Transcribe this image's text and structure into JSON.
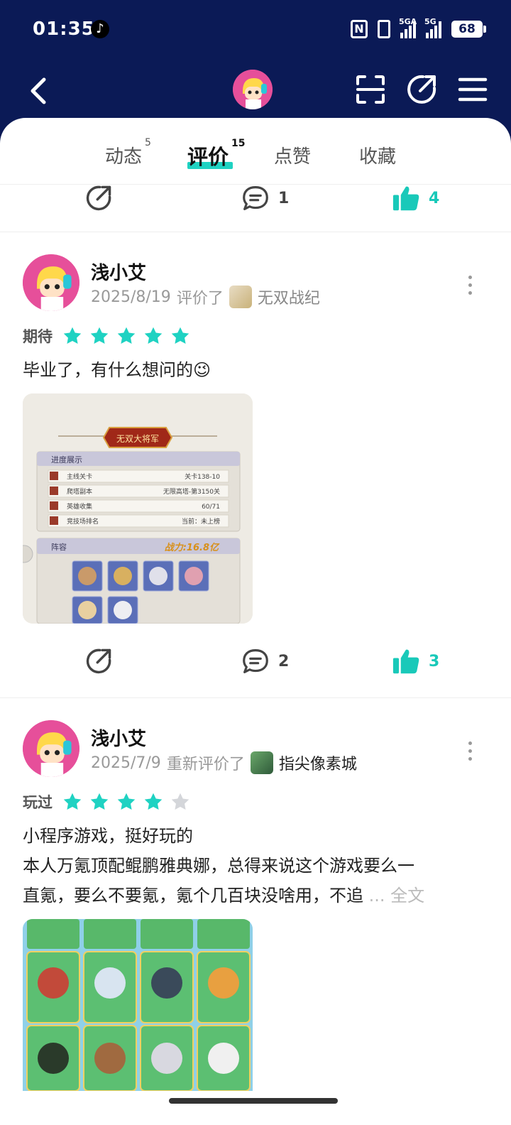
{
  "status_bar": {
    "time": "01:35",
    "battery": "68",
    "signal_labels": [
      "5GA",
      "5G"
    ]
  },
  "tabs": [
    {
      "label": "动态",
      "count": "5"
    },
    {
      "label": "评价",
      "count": "15"
    },
    {
      "label": "点赞",
      "count": ""
    },
    {
      "label": "收藏",
      "count": ""
    }
  ],
  "top_action_bar": {
    "comments": "1",
    "likes": "4"
  },
  "reviews": [
    {
      "user": "浅小艾",
      "date": "2025/8/19",
      "action": "评价了",
      "game": "无双战纪",
      "tag": "期待",
      "rating": 5,
      "text_lines": [
        "毕业了，有什么想问的😉"
      ],
      "fulltext": "",
      "comments": "2",
      "likes": "3",
      "image": {
        "banner": "无双大将军",
        "section1": "进度展示",
        "rows": [
          {
            "label": "主线关卡",
            "value": "关卡138-10"
          },
          {
            "label": "爬塔副本",
            "value": "无限高塔-第3150关"
          },
          {
            "label": "英雄收集",
            "value": "60/71"
          },
          {
            "label": "竞技场排名",
            "value": "当前：未上榜"
          }
        ],
        "section2": "阵容",
        "power": "战力:16.8亿"
      }
    },
    {
      "user": "浅小艾",
      "date": "2025/7/9",
      "action": "重新评价了",
      "game": "指尖像素城",
      "tag": "玩过",
      "rating": 4,
      "text_lines": [
        "小程序游戏，挺好玩的",
        "本人万氪顶配鲲鹏雅典娜，总得来说这个游戏要么一",
        "直氪，要么不要氪，氪个几百块没啥用，不追"
      ],
      "fulltext": "... 全文"
    }
  ],
  "colors": {
    "header": "#0b1a56",
    "accent": "#1fd2c2",
    "like": "#19c9b9",
    "avatar_bg": "#e64f9a"
  }
}
